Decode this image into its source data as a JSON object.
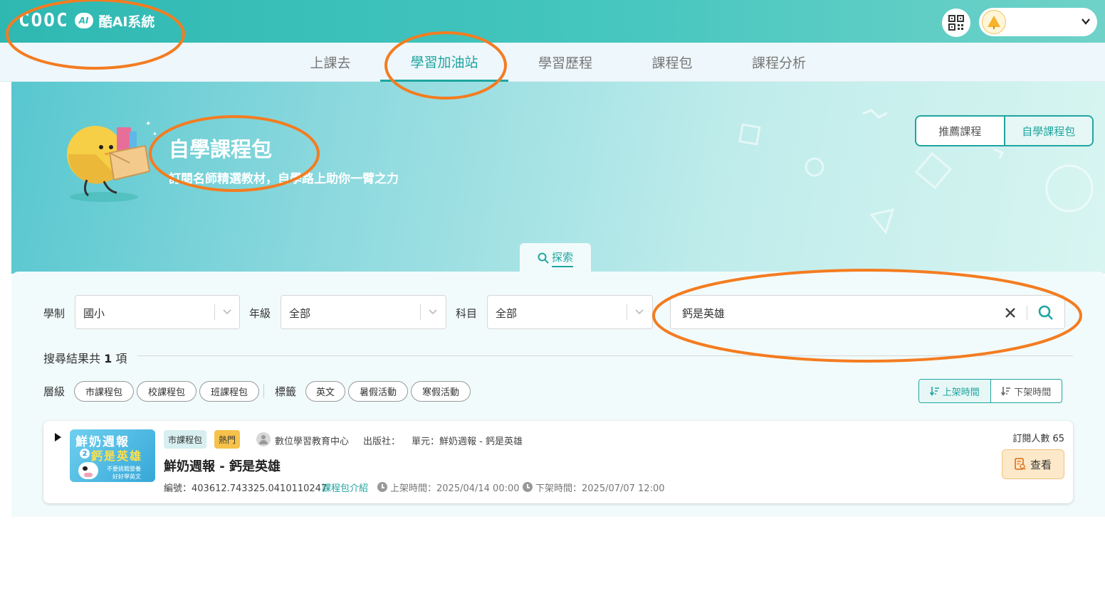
{
  "header": {
    "logo_mark": "COOC",
    "logo_ai": "AI",
    "logo_text": "酷AI系統"
  },
  "nav": {
    "items": [
      {
        "label": "上課去"
      },
      {
        "label": "學習加油站",
        "active": true
      },
      {
        "label": "學習歷程"
      },
      {
        "label": "課程包"
      },
      {
        "label": "課程分析"
      }
    ]
  },
  "banner": {
    "title": "自學課程包",
    "subtitle": "訂閱名師精選教材，自學路上助你一臂之力",
    "toggle": [
      {
        "label": "推薦課程"
      },
      {
        "label": "自學課程包",
        "active": true
      }
    ]
  },
  "explore_tab": {
    "label": "探索"
  },
  "filters": {
    "system": {
      "label": "學制",
      "value": "國小"
    },
    "grade": {
      "label": "年級",
      "value": "全部"
    },
    "subject": {
      "label": "科目",
      "value": "全部"
    },
    "search": {
      "value": "鈣是英雄"
    }
  },
  "results": {
    "prefix": "搜尋結果共",
    "count": "1",
    "suffix": "項"
  },
  "levels": {
    "label": "層級",
    "chips": [
      "市課程包",
      "校課程包",
      "班課程包"
    ]
  },
  "tags": {
    "label": "標籤",
    "chips": [
      "英文",
      "暑假活動",
      "寒假活動"
    ]
  },
  "sort": {
    "options": [
      {
        "label": "上架時間",
        "active": true
      },
      {
        "label": "下架時間"
      }
    ]
  },
  "card": {
    "thumbnail": {
      "line1": "鮮奶週報",
      "number": "2",
      "line2": "鈣是英雄",
      "line3": "不要挑戰營養",
      "line4": "好好學英文"
    },
    "level_tag": "市課程包",
    "hot_tag": "熱門",
    "author": "數位學習教育中心",
    "publisher": "出版社：",
    "unit": "單元：鮮奶週報 - 鈣是英雄",
    "title": "鮮奶週報 - 鈣是英雄",
    "code": "編號：403612.743325.0410110247",
    "intro_link": "課程包介紹",
    "publish_time": "上架時間：2025/04/14 00:00",
    "unpublish_time": "下架時間：2025/07/07 12:00",
    "subscribers": "訂閱人數 65",
    "view_button": "查看"
  },
  "colors": {
    "accent": "#1fa5a0",
    "header_start": "#2fb8b2",
    "hot_tag": "#f6c24b",
    "annotation": "#f47c20"
  }
}
